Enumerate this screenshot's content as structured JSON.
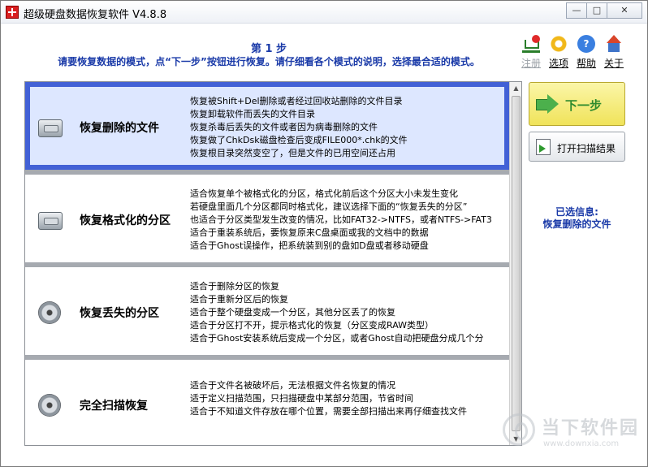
{
  "window": {
    "title": "超级硬盘数据恢复软件 V4.8.8",
    "minimize": "—",
    "maximize": "□",
    "close": "✕"
  },
  "header": {
    "step": "第 1 步",
    "description": "请要恢复数据的模式，点“下一步”按钮进行恢复。请仔细看各个模式的说明，选择最合适的模式。"
  },
  "tools": [
    {
      "label": "注册",
      "icon": "cart-icon",
      "enabled": false
    },
    {
      "label": "选项",
      "icon": "gear-icon",
      "enabled": true
    },
    {
      "label": "帮助",
      "icon": "help-icon",
      "glyph": "?",
      "enabled": true
    },
    {
      "label": "关于",
      "icon": "home-icon",
      "enabled": true
    }
  ],
  "options": [
    {
      "title": "恢复删除的文件",
      "icon": "hard-drive-icon",
      "selected": true,
      "lines": [
        "恢复被Shift+Del删除或者经过回收站删除的文件目录",
        "恢复卸载软件而丢失的文件目录",
        "恢复杀毒后丢失的文件或者因为病毒删除的文件",
        "恢复做了ChkDsk磁盘检查后变成FILE000*.chk的文件",
        "恢复根目录突然变空了，但是文件的已用空间还占用"
      ]
    },
    {
      "title": "恢复格式化的分区",
      "icon": "hard-drive-icon",
      "selected": false,
      "lines": [
        "适合恢复单个被格式化的分区，格式化前后这个分区大小未发生变化",
        "若硬盘里面几个分区都同时格式化，建议选择下面的“恢复丢失的分区”",
        "也适合于分区类型发生改变的情况，比如FAT32->NTFS，或者NTFS->FAT3",
        "适合于重装系统后，要恢复原来C盘桌面或我的文档中的数据",
        "适合于Ghost误操作，把系统装到别的盘如D盘或者移动硬盘"
      ]
    },
    {
      "title": "恢复丢失的分区",
      "icon": "disk-platter-icon",
      "selected": false,
      "lines": [
        "适合于删除分区的恢复",
        "适合于重新分区后的恢复",
        "适合于整个硬盘变成一个分区，其他分区丢了的恢复",
        "适合于分区打不开，提示格式化的恢复（分区变成RAW类型）",
        "适合于Ghost安装系统后变成一个分区，或者Ghost自动把硬盘分成几个分"
      ]
    },
    {
      "title": "完全扫描恢复",
      "icon": "disk-platter-icon",
      "selected": false,
      "lines": [
        "适合于文件名被破坏后，无法根据文件名恢复的情况",
        "适于定义扫描范围，只扫描硬盘中某部分范围，节省时间",
        "适合于不知道文件存放在哪个位置，需要全部扫描出来再仔细查找文件"
      ]
    }
  ],
  "side": {
    "next_label": "下一步",
    "open_scan_label": "打开扫描结果",
    "info_title": "已选信息:",
    "info_value": "恢复删除的文件"
  },
  "watermark": {
    "text": "当下软件园",
    "url": "www.downxia.com"
  }
}
